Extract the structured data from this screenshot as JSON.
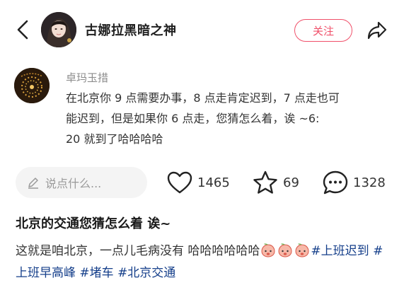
{
  "header": {
    "author_name": "古娜拉黑暗之神",
    "follow_label": "关注"
  },
  "comment": {
    "commenter_name": "卓玛玉措",
    "text_lines": [
      "在北京你 9 点需要办事，8 点走肯定迟到，7 点走也可",
      "能迟到，但是如果你 6 点走，您猜怎么着，诶 ~6:",
      "20 就到了哈哈哈哈"
    ]
  },
  "actions": {
    "comment_placeholder": "说点什么...",
    "likes": "1465",
    "favorites": "69",
    "comments": "1328"
  },
  "post": {
    "title": "北京的交通您猜怎么着 诶~",
    "body_text": "这就是咱北京，一点儿毛病没有 哈哈哈哈哈哈",
    "tags": [
      "#上班迟到",
      "#上班早高峰",
      "#堵车",
      "#北京交通"
    ]
  },
  "colors": {
    "accent": "#f0506a",
    "tag": "#143e8a"
  }
}
